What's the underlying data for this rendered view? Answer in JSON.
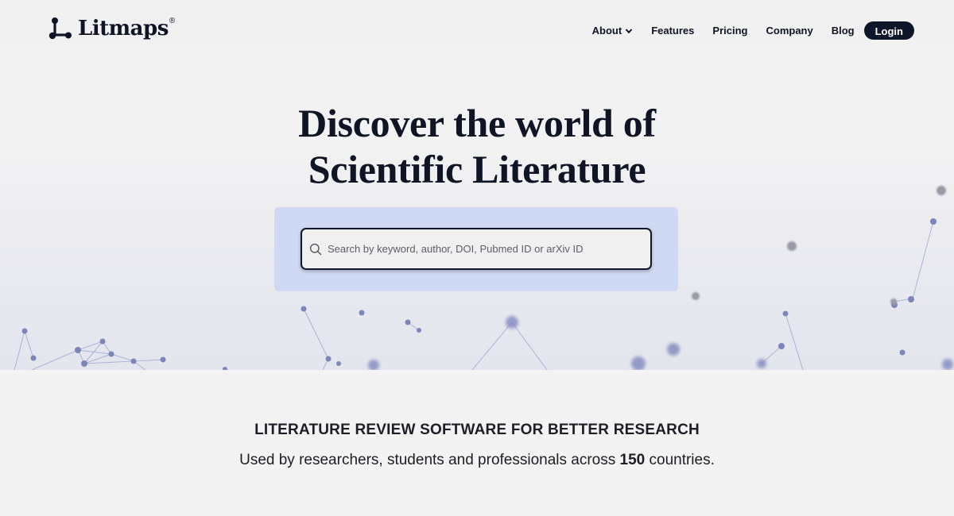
{
  "brand": {
    "name": "Litmaps",
    "registered_mark": "®",
    "colors": {
      "ink": "#0f1524",
      "search_panel": "#d0d9f4",
      "network_nodes": "#7d86b8"
    }
  },
  "nav": {
    "items": [
      {
        "label": "About",
        "has_dropdown": true,
        "icon": "chevron-down-icon"
      },
      {
        "label": "Features"
      },
      {
        "label": "Pricing"
      },
      {
        "label": "Company"
      },
      {
        "label": "Blog"
      }
    ],
    "login_label": "Login"
  },
  "hero": {
    "headline_line1": "Discover the world of",
    "headline_line2": "Scientific Literature",
    "search": {
      "placeholder": "Search by keyword, author, DOI, Pubmed ID or arXiv ID",
      "value": "",
      "icon": "search-icon"
    }
  },
  "section": {
    "tagline": "LITERATURE REVIEW SOFTWARE FOR BETTER RESEARCH",
    "subline_prefix": "Used by researchers, students and professionals across ",
    "subline_count": "150",
    "subline_suffix": " countries."
  }
}
